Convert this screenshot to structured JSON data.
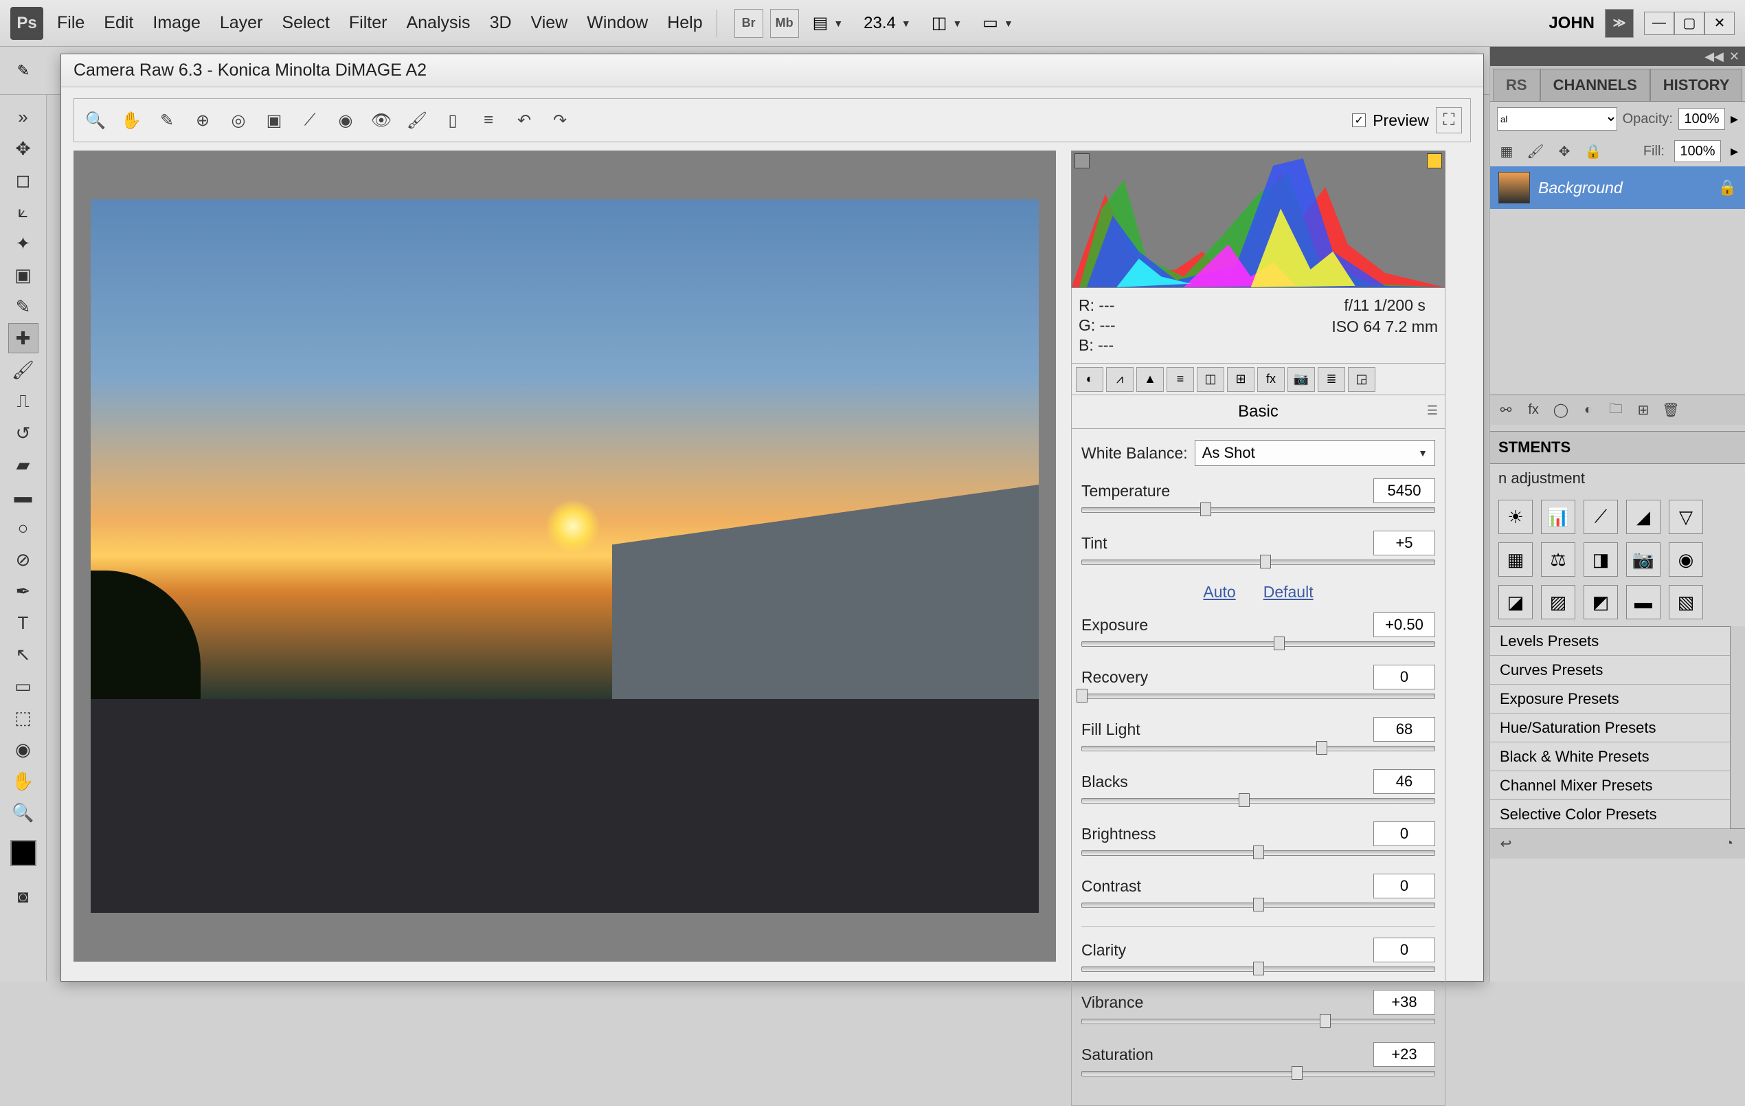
{
  "app": {
    "logo": "Ps",
    "user": "JOHN",
    "zoom": "23.4"
  },
  "menu": [
    "File",
    "Edit",
    "Image",
    "Layer",
    "Select",
    "Filter",
    "Analysis",
    "3D",
    "View",
    "Window",
    "Help"
  ],
  "top_btns": {
    "br": "Br",
    "mb": "Mb"
  },
  "craw": {
    "title": "Camera Raw 6.3  -  Konica Minolta DiMAGE A2",
    "preview_label": "Preview",
    "rgb": {
      "r": "R:   ---",
      "g": "G:   ---",
      "b": "B:   ---"
    },
    "exif": {
      "aperture_shutter": "f/11     1/200 s",
      "iso_focal": "ISO 64    7.2 mm"
    },
    "panel_title": "Basic",
    "wb_label": "White Balance:",
    "wb_value": "As Shot",
    "auto": "Auto",
    "default": "Default",
    "sliders": [
      {
        "label": "Temperature",
        "value": "5450",
        "pos": 35
      },
      {
        "label": "Tint",
        "value": "+5",
        "pos": 52
      },
      {
        "label": "Exposure",
        "value": "+0.50",
        "pos": 56
      },
      {
        "label": "Recovery",
        "value": "0",
        "pos": 0
      },
      {
        "label": "Fill Light",
        "value": "68",
        "pos": 68
      },
      {
        "label": "Blacks",
        "value": "46",
        "pos": 46
      },
      {
        "label": "Brightness",
        "value": "0",
        "pos": 50
      },
      {
        "label": "Contrast",
        "value": "0",
        "pos": 50
      },
      {
        "label": "Clarity",
        "value": "0",
        "pos": 50
      },
      {
        "label": "Vibrance",
        "value": "+38",
        "pos": 69
      },
      {
        "label": "Saturation",
        "value": "+23",
        "pos": 61
      }
    ]
  },
  "right": {
    "tabs": [
      "RS",
      "CHANNELS",
      "HISTORY"
    ],
    "blend_mode": "al",
    "opacity_label": "Opacity:",
    "opacity_value": "100%",
    "fill_label": "Fill:",
    "fill_value": "100%",
    "layer_name": "Background",
    "adj_title": "STMENTS",
    "adj_sub": "n adjustment",
    "presets": [
      "Levels Presets",
      "Curves Presets",
      "Exposure Presets",
      "Hue/Saturation Presets",
      "Black & White Presets",
      "Channel Mixer Presets",
      "Selective Color Presets"
    ]
  }
}
